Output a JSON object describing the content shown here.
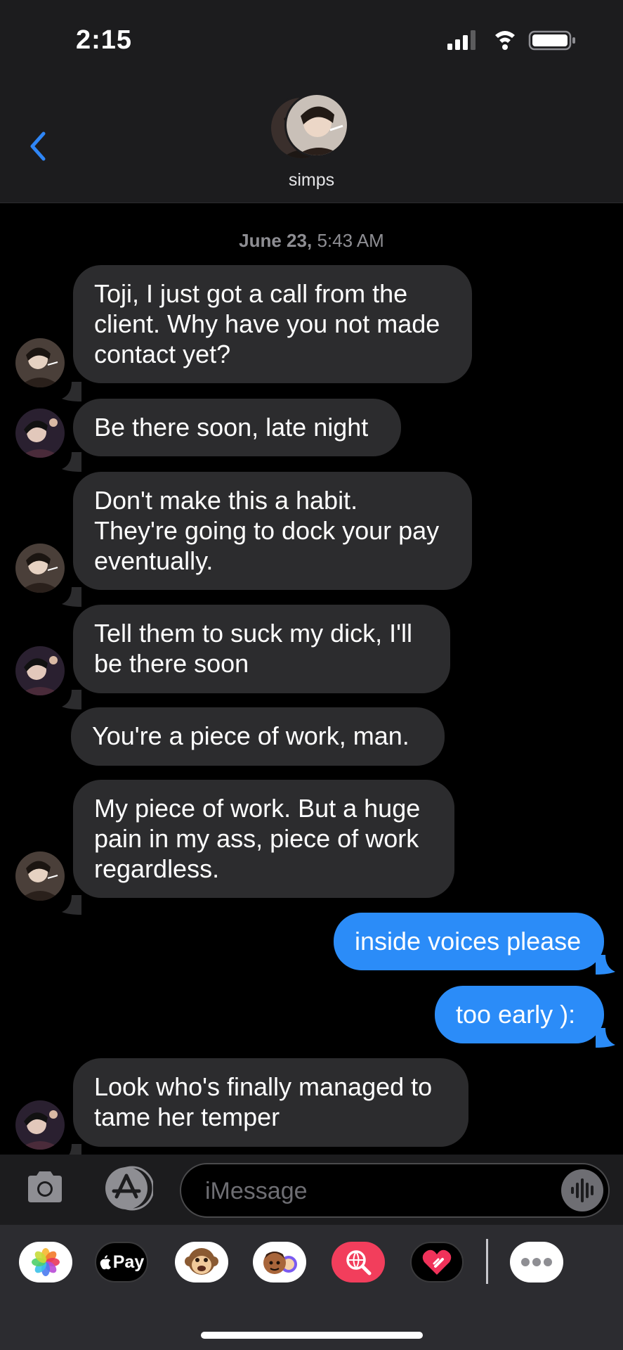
{
  "status_bar": {
    "time": "2:15"
  },
  "header": {
    "group_name": "simps"
  },
  "thread": {
    "timestamp_date": "June 23,",
    "timestamp_time": "5:43 AM",
    "messages": [
      {
        "direction": "incoming",
        "sender": "user-a",
        "text": "Toji, I just got a call from the\nclient. Why have you not made\ncontact yet?"
      },
      {
        "direction": "incoming",
        "sender": "user-b",
        "text": "Be there soon, late night"
      },
      {
        "direction": "incoming",
        "sender": "user-a",
        "text": "Don't make this a habit.\nThey're going to dock your pay\neventually."
      },
      {
        "direction": "incoming",
        "sender": "user-b",
        "text": "Tell them to suck my dick, I'll\nbe there soon"
      },
      {
        "direction": "incoming",
        "sender": "user-a",
        "text": "You're a piece of work, man."
      },
      {
        "direction": "incoming",
        "sender": "user-a",
        "text": "My piece of work. But a huge\npain in my ass, piece of work\nregardless."
      },
      {
        "direction": "outgoing",
        "text": "inside voices please"
      },
      {
        "direction": "outgoing",
        "text": "too early ):"
      },
      {
        "direction": "incoming",
        "sender": "user-b",
        "text": "Look who's finally managed to\ntame her temper"
      }
    ]
  },
  "composer": {
    "placeholder": "iMessage"
  },
  "app_drawer": {
    "apple_pay_label": "Pay",
    "apps": [
      "photos-app",
      "apple-pay-app",
      "animoji-app",
      "memoji-app",
      "image-search-app",
      "digital-touch-app",
      "more-apps"
    ]
  },
  "colors": {
    "outgoing_bubble": "#2b8cf8",
    "incoming_bubble": "#2c2c2e",
    "header_background": "#1c1c1e",
    "accent": "#2f86f6"
  }
}
